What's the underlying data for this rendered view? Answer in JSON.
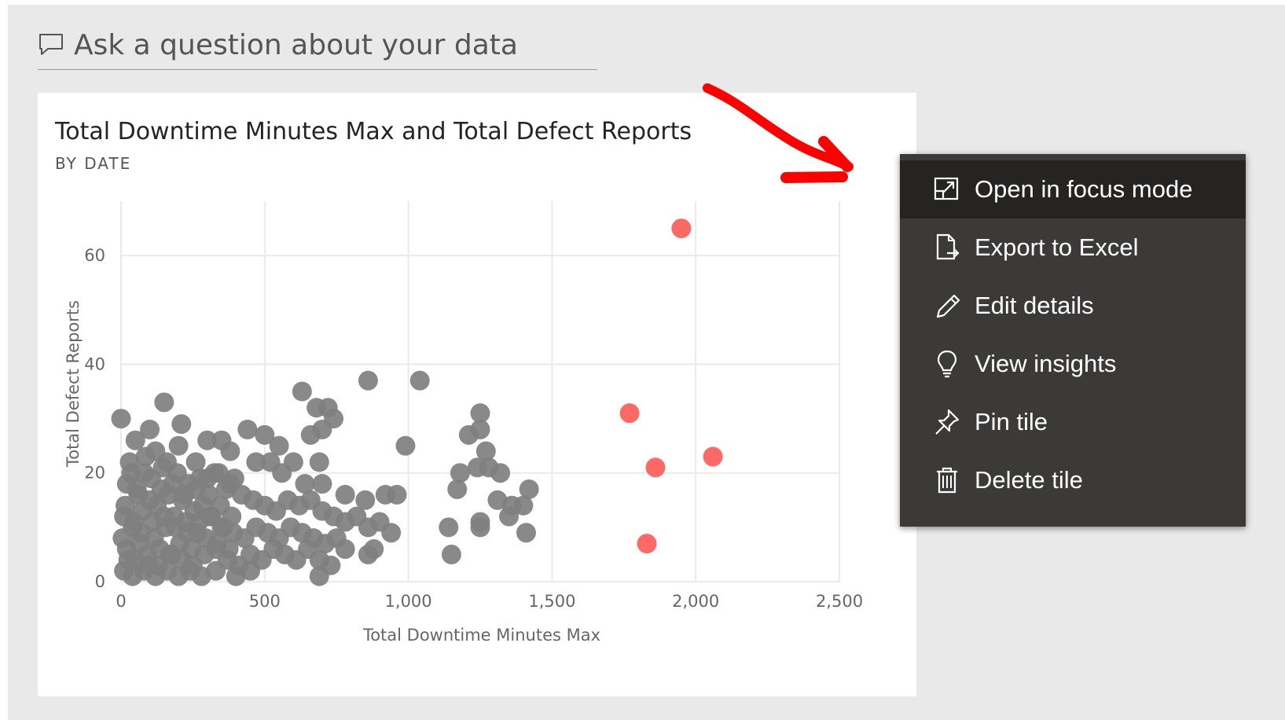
{
  "qa": {
    "placeholder": "Ask a question about your data",
    "icon": "chat-bubble-icon"
  },
  "tile": {
    "title": "Total Downtime Minutes Max and Total Defect Reports",
    "subtitle": "BY DATE"
  },
  "menu": {
    "items": [
      {
        "label": "Open in focus mode",
        "icon": "focus-mode-icon",
        "active": true
      },
      {
        "label": "Export to Excel",
        "icon": "export-icon",
        "active": false
      },
      {
        "label": "Edit details",
        "icon": "pencil-icon",
        "active": false
      },
      {
        "label": "View insights",
        "icon": "lightbulb-icon",
        "active": false
      },
      {
        "label": "Pin tile",
        "icon": "pin-icon",
        "active": false
      },
      {
        "label": "Delete tile",
        "icon": "trash-icon",
        "active": false
      }
    ]
  },
  "annotation": {
    "color": "#ff0000"
  },
  "chart_data": {
    "type": "scatter",
    "title": "Total Downtime Minutes Max and Total Defect Reports",
    "subtitle": "BY DATE",
    "xlabel": "Total Downtime Minutes Max",
    "ylabel": "Total Defect Reports",
    "xlim": [
      0,
      2500
    ],
    "ylim": [
      0,
      70
    ],
    "xticks": [
      0,
      500,
      1000,
      1500,
      2000,
      2500
    ],
    "xtick_labels": [
      "0",
      "500",
      "1,000",
      "1,500",
      "2,000",
      "2,500"
    ],
    "yticks": [
      0,
      20,
      40,
      60
    ],
    "ytick_labels": [
      "0",
      "20",
      "40",
      "60"
    ],
    "grid": true,
    "series": [
      {
        "color": "#7f7f7f",
        "points": [
          [
            0,
            30
          ],
          [
            150,
            33
          ],
          [
            210,
            29
          ],
          [
            100,
            28
          ],
          [
            50,
            26
          ],
          [
            120,
            24
          ],
          [
            200,
            25
          ],
          [
            30,
            22
          ],
          [
            80,
            20
          ],
          [
            160,
            22
          ],
          [
            260,
            22
          ],
          [
            300,
            26
          ],
          [
            350,
            26
          ],
          [
            380,
            24
          ],
          [
            440,
            28
          ],
          [
            500,
            27
          ],
          [
            550,
            25
          ],
          [
            470,
            22
          ],
          [
            520,
            22
          ],
          [
            630,
            35
          ],
          [
            680,
            32
          ],
          [
            720,
            32
          ],
          [
            740,
            30
          ],
          [
            700,
            28
          ],
          [
            660,
            27
          ],
          [
            860,
            37
          ],
          [
            1040,
            37
          ],
          [
            990,
            25
          ],
          [
            600,
            22
          ],
          [
            690,
            22
          ],
          [
            560,
            20
          ],
          [
            640,
            18
          ],
          [
            700,
            18
          ],
          [
            780,
            16
          ],
          [
            850,
            15
          ],
          [
            920,
            16
          ],
          [
            960,
            16
          ],
          [
            20,
            18
          ],
          [
            60,
            16
          ],
          [
            100,
            15
          ],
          [
            140,
            17
          ],
          [
            180,
            18
          ],
          [
            220,
            16
          ],
          [
            260,
            17
          ],
          [
            300,
            19
          ],
          [
            340,
            20
          ],
          [
            380,
            18
          ],
          [
            420,
            16
          ],
          [
            460,
            15
          ],
          [
            500,
            14
          ],
          [
            540,
            13
          ],
          [
            580,
            15
          ],
          [
            620,
            14
          ],
          [
            660,
            15
          ],
          [
            700,
            13
          ],
          [
            740,
            12
          ],
          [
            780,
            11
          ],
          [
            820,
            12
          ],
          [
            860,
            10
          ],
          [
            900,
            11
          ],
          [
            940,
            9
          ],
          [
            10,
            12
          ],
          [
            40,
            10
          ],
          [
            70,
            9
          ],
          [
            110,
            11
          ],
          [
            150,
            12
          ],
          [
            190,
            10
          ],
          [
            230,
            9
          ],
          [
            270,
            11
          ],
          [
            310,
            12
          ],
          [
            350,
            10
          ],
          [
            390,
            9
          ],
          [
            430,
            8
          ],
          [
            470,
            10
          ],
          [
            510,
            9
          ],
          [
            550,
            8
          ],
          [
            590,
            10
          ],
          [
            630,
            9
          ],
          [
            670,
            8
          ],
          [
            710,
            7
          ],
          [
            750,
            8
          ],
          [
            20,
            6
          ],
          [
            50,
            4
          ],
          [
            90,
            5
          ],
          [
            130,
            3
          ],
          [
            170,
            5
          ],
          [
            210,
            4
          ],
          [
            250,
            3
          ],
          [
            290,
            5
          ],
          [
            330,
            6
          ],
          [
            370,
            4
          ],
          [
            410,
            3
          ],
          [
            450,
            5
          ],
          [
            490,
            4
          ],
          [
            530,
            6
          ],
          [
            570,
            5
          ],
          [
            610,
            4
          ],
          [
            650,
            6
          ],
          [
            690,
            4
          ],
          [
            730,
            3
          ],
          [
            780,
            6
          ],
          [
            10,
            2
          ],
          [
            40,
            1
          ],
          [
            80,
            2
          ],
          [
            120,
            1
          ],
          [
            160,
            2
          ],
          [
            200,
            1
          ],
          [
            240,
            2
          ],
          [
            280,
            1
          ],
          [
            330,
            2
          ],
          [
            400,
            1
          ],
          [
            450,
            2
          ],
          [
            690,
            1
          ],
          [
            860,
            5
          ],
          [
            880,
            6
          ],
          [
            5,
            8
          ],
          [
            15,
            14
          ],
          [
            25,
            4
          ],
          [
            35,
            20
          ],
          [
            45,
            11
          ],
          [
            55,
            17
          ],
          [
            65,
            7
          ],
          [
            75,
            13
          ],
          [
            85,
            23
          ],
          [
            95,
            3
          ],
          [
            105,
            19
          ],
          [
            115,
            8
          ],
          [
            125,
            14
          ],
          [
            135,
            6
          ],
          [
            145,
            21
          ],
          [
            155,
            10
          ],
          [
            165,
            16
          ],
          [
            175,
            5
          ],
          [
            185,
            12
          ],
          [
            195,
            20
          ],
          [
            205,
            7
          ],
          [
            215,
            15
          ],
          [
            225,
            11
          ],
          [
            235,
            18
          ],
          [
            245,
            6
          ],
          [
            255,
            13
          ],
          [
            265,
            9
          ],
          [
            275,
            19
          ],
          [
            285,
            14
          ],
          [
            295,
            8
          ],
          [
            305,
            16
          ],
          [
            315,
            12
          ],
          [
            325,
            20
          ],
          [
            335,
            7
          ],
          [
            345,
            14
          ],
          [
            355,
            10
          ],
          [
            365,
            17
          ],
          [
            375,
            6
          ],
          [
            385,
            12
          ],
          [
            395,
            19
          ],
          [
            1250,
            31
          ],
          [
            1210,
            27
          ],
          [
            1250,
            28
          ],
          [
            1270,
            24
          ],
          [
            1180,
            20
          ],
          [
            1240,
            21
          ],
          [
            1320,
            20
          ],
          [
            1280,
            21
          ],
          [
            1170,
            17
          ],
          [
            1420,
            17
          ],
          [
            1310,
            15
          ],
          [
            1360,
            14
          ],
          [
            1400,
            14
          ],
          [
            1350,
            12
          ],
          [
            1250,
            11
          ],
          [
            1140,
            10
          ],
          [
            1250,
            10
          ],
          [
            1410,
            9
          ],
          [
            1150,
            5
          ]
        ]
      },
      {
        "color": "#fd625e",
        "points": [
          [
            1950,
            65
          ],
          [
            1770,
            31
          ],
          [
            1860,
            21
          ],
          [
            2060,
            23
          ],
          [
            1830,
            7
          ]
        ]
      }
    ]
  }
}
